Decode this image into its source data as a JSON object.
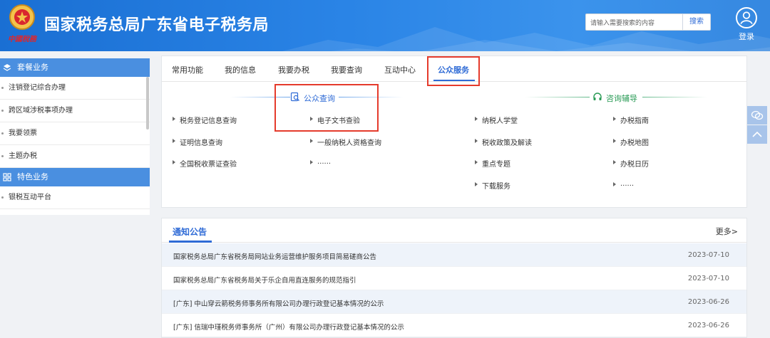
{
  "header": {
    "title": "国家税务总局广东省电子税务局",
    "emblem_caption": "中國稅務",
    "search_placeholder": "请输入需要搜索的内容",
    "search_button": "搜索",
    "login_label": "登录",
    "brand_color": "#2a84e6"
  },
  "sidebar": {
    "groups": [
      {
        "title": "套餐业务",
        "icon": "layers-icon",
        "items": [
          "注销登记综合办理",
          "跨区域涉税事项办理",
          "我要领票",
          "主题办税"
        ]
      },
      {
        "title": "特色业务",
        "icon": "grid-icon",
        "items": [
          "银税互动平台"
        ]
      }
    ]
  },
  "tabs": [
    "常用功能",
    "我的信息",
    "我要办税",
    "我要查询",
    "互动中心",
    "公众服务"
  ],
  "active_tab": "公众服务",
  "public_query": {
    "heading": "公众查询",
    "col1": [
      "税务登记信息查询",
      "证明信息查询",
      "全国税收票证查验"
    ],
    "col2": [
      "电子文书查验",
      "一般纳税人资格查询",
      "......"
    ]
  },
  "consulting": {
    "heading": "咨询辅导",
    "col1": [
      "纳税人学堂",
      "税收政策及解读",
      "重点专题",
      "下载服务"
    ],
    "col2": [
      "办税指南",
      "办税地图",
      "办税日历",
      "......"
    ]
  },
  "notices": {
    "title": "通知公告",
    "more": "更多>",
    "rows": [
      {
        "text": "国家税务总局广东省税务局网站业务运营维护服务项目简易磋商公告",
        "date": "2023-07-10"
      },
      {
        "text": "国家税务总局广东省税务局关于乐企自用直连服务的规范指引",
        "date": "2023-07-10"
      },
      {
        "text": "[广东] 中山穿云箭税务师事务所有限公司办理行政登记基本情况的公示",
        "date": "2023-06-26"
      },
      {
        "text": "[广东] 信瑞中瑾税务师事务所（广州）有限公司办理行政登记基本情况的公示",
        "date": "2023-06-26"
      }
    ]
  },
  "highlight_color": "#e53b2c"
}
